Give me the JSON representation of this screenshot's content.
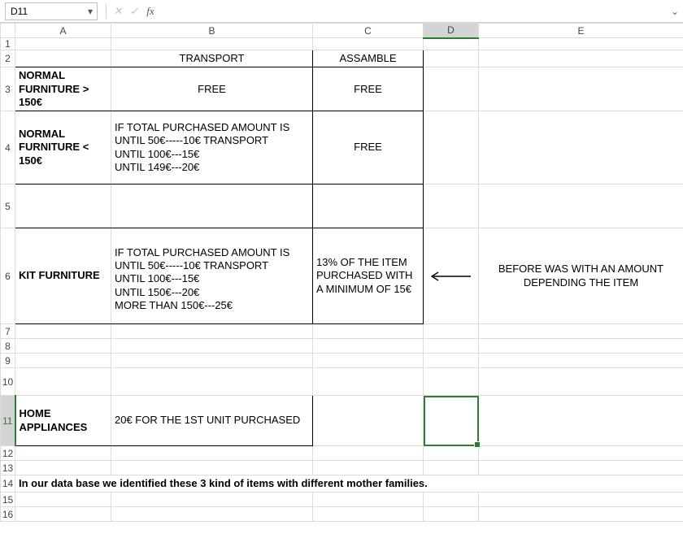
{
  "header": {
    "name_box": "D11",
    "formula": ""
  },
  "columns": [
    "A",
    "B",
    "C",
    "D",
    "E"
  ],
  "rows": [
    "1",
    "2",
    "3",
    "4",
    "5",
    "6",
    "7",
    "8",
    "9",
    "10",
    "11",
    "12",
    "13",
    "14",
    "15",
    "16"
  ],
  "active_cell": "D11",
  "cells": {
    "B2": "TRANSPORT",
    "C2": "ASSAMBLE",
    "A3": "NORMAL FURNITURE > 150€",
    "B3": "FREE",
    "C3": "FREE",
    "A4": "NORMAL FURNITURE < 150€",
    "B4": "IF TOTAL PURCHASED AMOUNT IS\nUNTIL 50€-----10€ TRANSPORT\nUNTIL 100€---15€\nUNTIL 149€---20€",
    "C4": "FREE",
    "A6": "KIT FURNITURE",
    "B6": "IF TOTAL PURCHASED AMOUNT IS\nUNTIL 50€-----10€ TRANSPORT\nUNTIL 100€---15€\nUNTIL 150€---20€\nMORE THAN 150€---25€",
    "C6": "13% OF THE ITEM PURCHASED WITH A MINIMUM OF 15€",
    "E6": "BEFORE WAS WITH AN AMOUNT DEPENDING THE ITEM",
    "A11": "HOME APPLIANCES",
    "B11": "20€ FOR THE 1ST UNIT PURCHASED",
    "A14": "In our data base we identified these 3 kind of items with different mother families."
  },
  "icons": {
    "dropdown": "▾",
    "cancel": "✕",
    "enter": "✓",
    "fx": "fx",
    "expand": "⌄"
  }
}
